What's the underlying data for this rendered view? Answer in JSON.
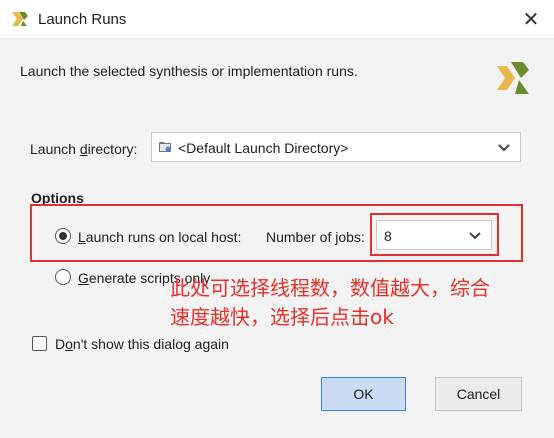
{
  "window": {
    "title": "Launch Runs",
    "close_glyph": "✕",
    "logo_icon": "vivado-logo-icon"
  },
  "description": "Launch the selected synthesis or implementation runs.",
  "launch_directory": {
    "label_first": "Launch ",
    "label_mnemonic": "d",
    "label_rest": "irectory:",
    "value": "<Default Launch Directory>",
    "icon": "folder-icon"
  },
  "options": {
    "heading": "Options",
    "local_host": {
      "label_mnemonic": "L",
      "label_rest": "aunch runs on local host:",
      "selected": true
    },
    "jobs": {
      "label": "Number of jobs:",
      "value": "8"
    },
    "scripts": {
      "label_mnemonic": "G",
      "label_rest": "enerate scripts only",
      "selected": false
    }
  },
  "annotation": {
    "line1": "此处可选择线程数，数值越大，综合",
    "line2": "速度越快，选择后点击ok",
    "color": "#e8302a"
  },
  "dont_show": {
    "label_first": "D",
    "label_mnemonic": "o",
    "label_rest": "n't show this dialog again",
    "checked": false
  },
  "buttons": {
    "ok": "OK",
    "cancel": "Cancel"
  },
  "colors": {
    "highlight_box": "#e03030",
    "ok_button_bg": "#c9dcf3",
    "ok_button_border": "#3e87d9"
  }
}
